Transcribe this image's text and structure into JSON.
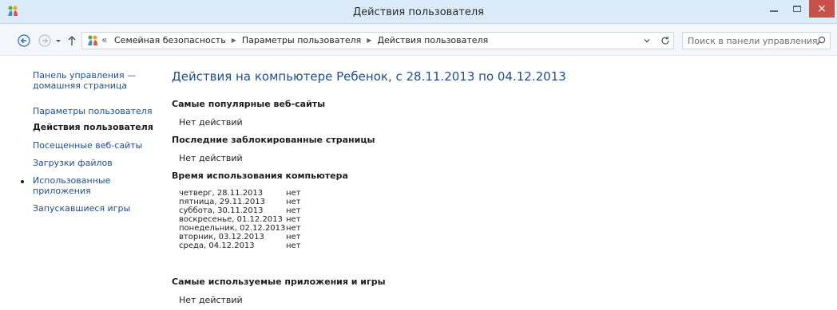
{
  "window": {
    "title": "Действия пользователя",
    "close_glyph": "×"
  },
  "address": {
    "overflow": "«",
    "crumbs": [
      "Семейная безопасность",
      "Параметры пользователя",
      "Действия пользователя"
    ],
    "separator": "▶"
  },
  "search": {
    "placeholder": "Поиск в панели управления"
  },
  "sidebar": {
    "home_line1": "Панель управления —",
    "home_line2": "домашняя страница",
    "user_settings": "Параметры пользователя",
    "user_activity": "Действия пользователя",
    "visited_sites": "Посещенные веб-сайты",
    "downloads": "Загрузки файлов",
    "apps_line1": "Использованные",
    "apps_line2": "приложения",
    "games": "Запускавшиеся игры"
  },
  "main": {
    "title": "Действия на компьютере Ребенок, с 28.11.2013 по 04.12.2013",
    "popular_sites": {
      "heading": "Самые популярные веб-сайты",
      "value": "Нет действий"
    },
    "blocked_pages": {
      "heading": "Последние заблокированные страницы",
      "value": "Нет действий"
    },
    "usage": {
      "heading": "Время использования компьютера",
      "rows": [
        {
          "day": "четверг, 28.11.2013",
          "value": "нет"
        },
        {
          "day": "пятница, 29.11.2013",
          "value": "нет"
        },
        {
          "day": "суббота, 30.11.2013",
          "value": "нет"
        },
        {
          "day": "воскресенье, 01.12.2013",
          "value": "нет"
        },
        {
          "day": "понедельник, 02.12.2013",
          "value": "нет"
        },
        {
          "day": "вторник, 03.12.2013",
          "value": "нет"
        },
        {
          "day": "среда, 04.12.2013",
          "value": "нет"
        }
      ]
    },
    "apps_games": {
      "heading": "Самые используемые приложения и игры",
      "value": "Нет действий"
    }
  },
  "icons": {
    "app": "family-safety-icon",
    "back": "back-arrow-icon",
    "forward": "forward-arrow-icon",
    "recent": "chevron-down-icon",
    "up": "up-arrow-icon",
    "refresh": "refresh-icon",
    "search": "search-icon"
  },
  "colors": {
    "titlebar": "#dcebfa",
    "close": "#c7504a",
    "link": "#1e4e8c"
  }
}
